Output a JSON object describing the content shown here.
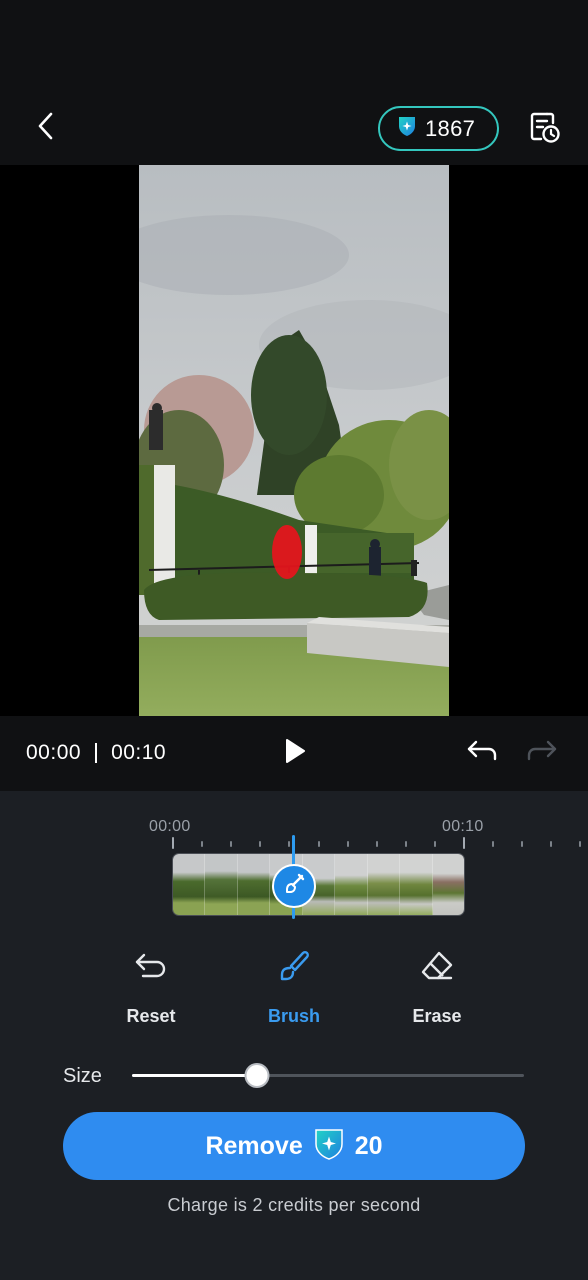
{
  "header": {
    "back_icon": "chevron-left-icon",
    "credits": "1867",
    "credit_icon": "credit-shield-icon",
    "history_icon": "history-list-icon",
    "accent": "#34c7be"
  },
  "preview": {
    "mask_color": "#e8141c"
  },
  "playback": {
    "current_time": "00:00",
    "duration": "00:10",
    "play_icon": "play-icon",
    "undo_icon": "undo-icon",
    "redo_icon": "redo-icon"
  },
  "timeline": {
    "start_label": "00:00",
    "end_label": "00:10",
    "playhead_icon": "brush-icon"
  },
  "tools": [
    {
      "label": "Reset",
      "icon": "reset-arrow-icon",
      "active": false
    },
    {
      "label": "Brush",
      "icon": "brush-icon",
      "active": true
    },
    {
      "label": "Erase",
      "icon": "eraser-icon",
      "active": false
    }
  ],
  "size": {
    "label": "Size",
    "value_fraction": 0.32
  },
  "action": {
    "label": "Remove",
    "cost": "20",
    "note": "Charge is 2 credits per second",
    "color": "#2f8cf0"
  }
}
